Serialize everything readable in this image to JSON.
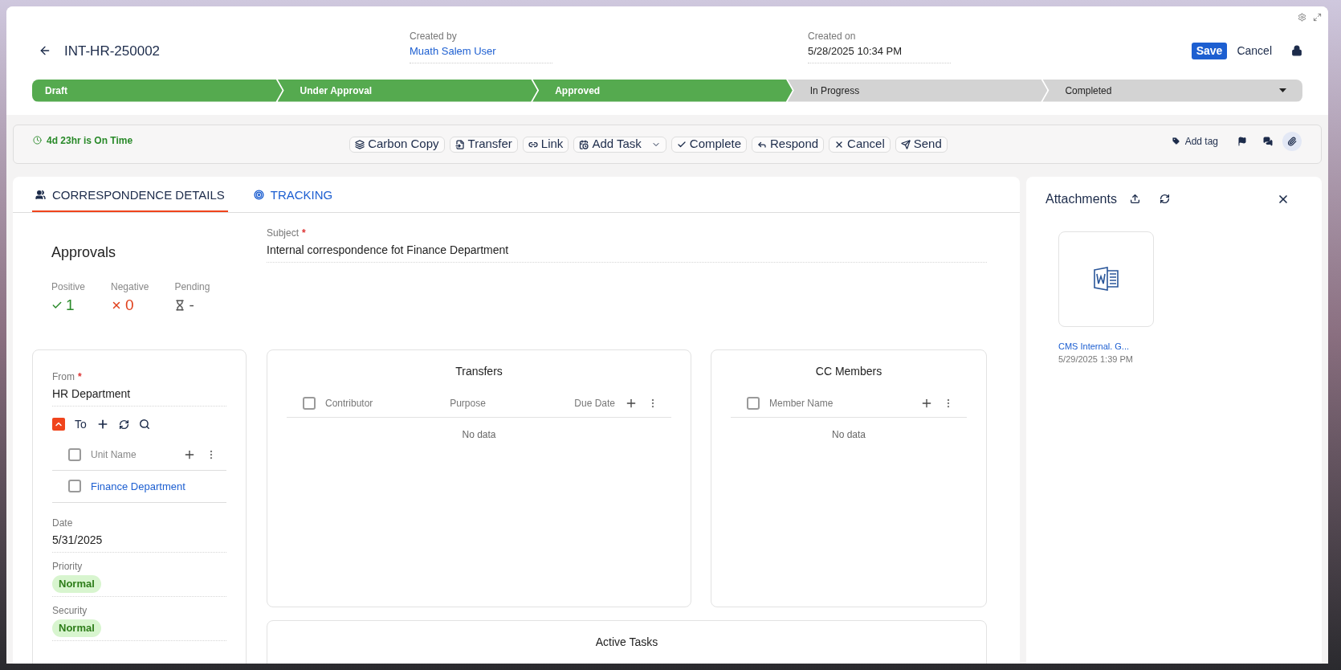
{
  "header": {
    "title": "INT-HR-250002",
    "created_by": {
      "label": "Created by",
      "value": "Muath Salem User"
    },
    "created_on": {
      "label": "Created on",
      "value": "5/28/2025 10:34 PM"
    },
    "save": "Save",
    "cancel": "Cancel"
  },
  "stages": [
    {
      "label": "Draft",
      "done": true
    },
    {
      "label": "Under Approval",
      "done": true
    },
    {
      "label": "Approved",
      "done": true
    },
    {
      "label": "In Progress",
      "done": false
    },
    {
      "label": "Completed",
      "done": false
    }
  ],
  "timer": "4d 23hr is On Time",
  "actions": [
    {
      "label": "Carbon Copy",
      "has_menu": false
    },
    {
      "label": "Transfer",
      "has_menu": false
    },
    {
      "label": "Link",
      "has_menu": false
    },
    {
      "label": "Add Task",
      "has_menu": true
    },
    {
      "label": "Complete",
      "has_menu": false
    },
    {
      "label": "Respond",
      "has_menu": false
    },
    {
      "label": "Cancel",
      "has_menu": false
    },
    {
      "label": "Send",
      "has_menu": false
    }
  ],
  "add_tag": "Add tag",
  "tabs": [
    {
      "label": "CORRESPONDENCE DETAILS",
      "selected": true
    },
    {
      "label": "TRACKING",
      "selected": false
    }
  ],
  "approvals": {
    "title": "Approvals",
    "positive": {
      "label": "Positive",
      "value": "1"
    },
    "negative": {
      "label": "Negative",
      "value": "0"
    },
    "pending": {
      "label": "Pending",
      "value": "-"
    }
  },
  "subject": {
    "label": "Subject",
    "required_mark": "*",
    "value": "Internal correspondence fot Finance Department"
  },
  "from": {
    "label": "From",
    "required_mark": "*",
    "value": "HR Department"
  },
  "to": {
    "label": "To",
    "expanded": true
  },
  "units": {
    "column": "Unit Name",
    "all_checked": false,
    "rows": [
      {
        "name": "Finance Department",
        "checked": false
      }
    ]
  },
  "date": {
    "label": "Date",
    "value": "5/31/2025"
  },
  "priority": {
    "label": "Priority",
    "value": "Normal"
  },
  "security": {
    "label": "Security",
    "value": "Normal"
  },
  "transfers": {
    "title": "Transfers",
    "all_checked": false,
    "columns": [
      "Contributor",
      "Purpose",
      "Due Date"
    ],
    "empty": "No data"
  },
  "cc_members": {
    "title": "CC Members",
    "all_checked": false,
    "columns": [
      "Member Name"
    ],
    "empty": "No data"
  },
  "active_tasks": {
    "title": "Active Tasks"
  },
  "attachments": {
    "title": "Attachments",
    "files": [
      {
        "name": "CMS Internal. G...",
        "date": "5/29/2025 1:39 PM"
      }
    ]
  }
}
